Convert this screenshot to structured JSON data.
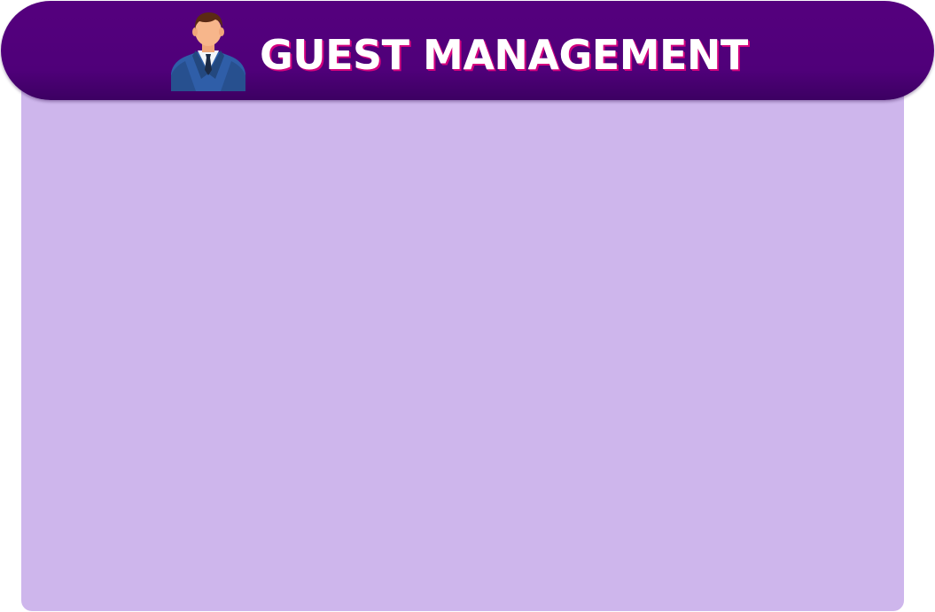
{
  "header": {
    "title": "GUEST MANAGEMENT",
    "icon": "businessman-avatar-icon"
  },
  "colors": {
    "header_background": "#4f0079",
    "panel_background": "#ceb6ec",
    "title_text": "#ffffff",
    "title_shadow": "#d4007e"
  }
}
